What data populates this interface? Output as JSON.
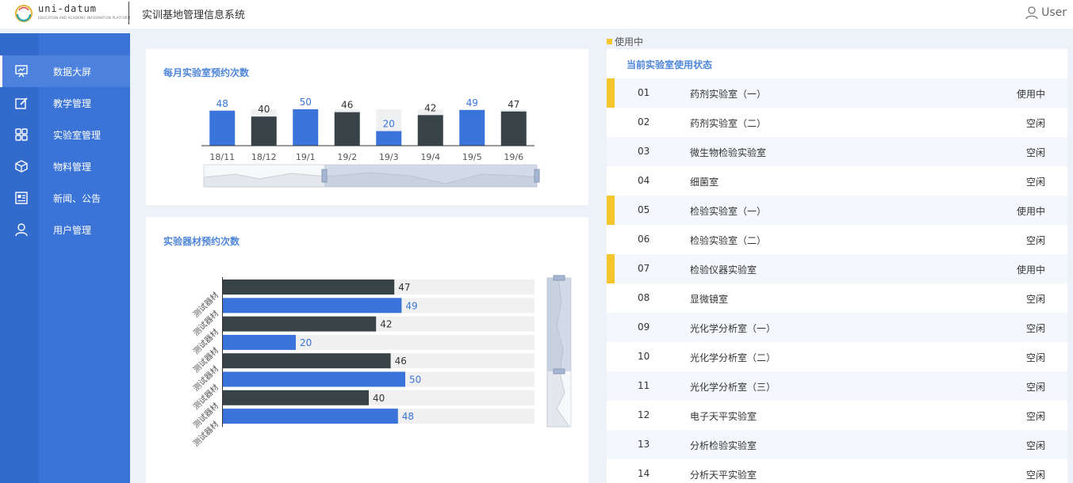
{
  "header": {
    "logo_text": "uni-datum",
    "logo_sub": "EDUCATION AND ACADEMIC INFORMATION PLATFORM",
    "app_title": "实训基地管理信息系统",
    "user_label": "User"
  },
  "sidebar": {
    "items": [
      {
        "label": "数据大屏",
        "icon": "dashboard-icon",
        "active": true
      },
      {
        "label": "教学管理",
        "icon": "edit-icon",
        "active": false
      },
      {
        "label": "实验室管理",
        "icon": "grid-icon",
        "active": false
      },
      {
        "label": "物料管理",
        "icon": "box-icon",
        "active": false
      },
      {
        "label": "新闻、公告",
        "icon": "news-icon",
        "active": false
      },
      {
        "label": "用户管理",
        "icon": "user-icon",
        "active": false
      }
    ]
  },
  "monthly_card": {
    "title": "每月实验室预约次数"
  },
  "equipment_card": {
    "title": "实验器材预约次数"
  },
  "status": {
    "legend": "使用中",
    "title": "当前实验室使用状态",
    "rows": [
      {
        "num": "01",
        "name": "药剂实验室（一）",
        "status": "使用中",
        "in_use": true
      },
      {
        "num": "02",
        "name": "药剂实验室（二）",
        "status": "空闲",
        "in_use": false
      },
      {
        "num": "03",
        "name": "微生物检验实验室",
        "status": "空闲",
        "in_use": false
      },
      {
        "num": "04",
        "name": "细菌室",
        "status": "空闲",
        "in_use": false
      },
      {
        "num": "05",
        "name": "检验实验室（一）",
        "status": "使用中",
        "in_use": true
      },
      {
        "num": "06",
        "name": "检验实验室（二）",
        "status": "空闲",
        "in_use": false
      },
      {
        "num": "07",
        "name": "检验仪器实验室",
        "status": "使用中",
        "in_use": true
      },
      {
        "num": "08",
        "name": "显微镜室",
        "status": "空闲",
        "in_use": false
      },
      {
        "num": "09",
        "name": "光化学分析室（一）",
        "status": "空闲",
        "in_use": false
      },
      {
        "num": "10",
        "name": "光化学分析室（二）",
        "status": "空闲",
        "in_use": false
      },
      {
        "num": "11",
        "name": "光化学分析室（三）",
        "status": "空闲",
        "in_use": false
      },
      {
        "num": "12",
        "name": "电子天平实验室",
        "status": "空闲",
        "in_use": false
      },
      {
        "num": "13",
        "name": "分析检验实验室",
        "status": "空闲",
        "in_use": false
      },
      {
        "num": "14",
        "name": "分析天平实验室",
        "status": "空闲",
        "in_use": false
      }
    ]
  },
  "colors": {
    "accent_blue": "#3a73d9",
    "dark_bar": "#374346",
    "in_use_yellow": "#f4c62b",
    "sidebar": "#3b74d6"
  },
  "chart_data": [
    {
      "type": "bar",
      "title": "每月实验室预约次数",
      "categories": [
        "18/11",
        "18/12",
        "19/1",
        "19/2",
        "19/3",
        "19/4",
        "19/5",
        "19/6"
      ],
      "values": [
        48,
        40,
        50,
        46,
        20,
        42,
        49,
        47
      ],
      "ylim": [
        0,
        50
      ],
      "data_labels": true,
      "grid": false,
      "has_data_zoom": true
    },
    {
      "type": "bar",
      "orientation": "horizontal",
      "title": "实验器材预约次数",
      "categories": [
        "测试器材",
        "测试器材",
        "测试器材",
        "测试器材",
        "测试器材",
        "测试器材",
        "测试器材",
        "测试器材"
      ],
      "values": [
        47,
        49,
        42,
        20,
        46,
        50,
        40,
        48
      ],
      "xlim": [
        0,
        50
      ],
      "data_labels": true,
      "grid": false,
      "has_data_zoom": true
    }
  ]
}
